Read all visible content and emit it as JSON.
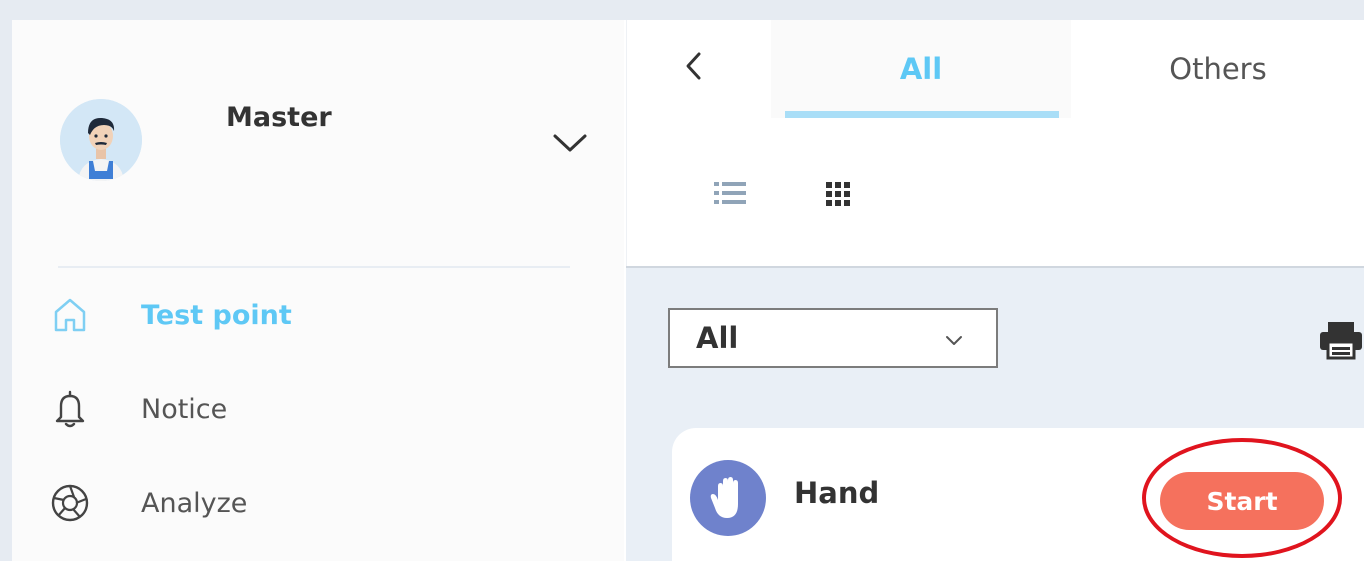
{
  "user": {
    "name": "Master"
  },
  "sidebar": {
    "items": [
      {
        "label": "Test point",
        "icon": "home-icon",
        "active": true
      },
      {
        "label": "Notice",
        "icon": "bell-icon",
        "active": false
      },
      {
        "label": "Analyze",
        "icon": "aperture-icon",
        "active": false
      }
    ]
  },
  "tabs": [
    {
      "label": "All",
      "active": true
    },
    {
      "label": "Others",
      "active": false
    }
  ],
  "filter": {
    "selected": "All"
  },
  "card": {
    "title": "Hand",
    "icon": "hand-icon",
    "button_label": "Start"
  },
  "colors": {
    "accent": "#5ec8f5",
    "start_button": "#f5715d",
    "highlight": "#e0141e",
    "card_icon_bg": "#6f82cc"
  }
}
